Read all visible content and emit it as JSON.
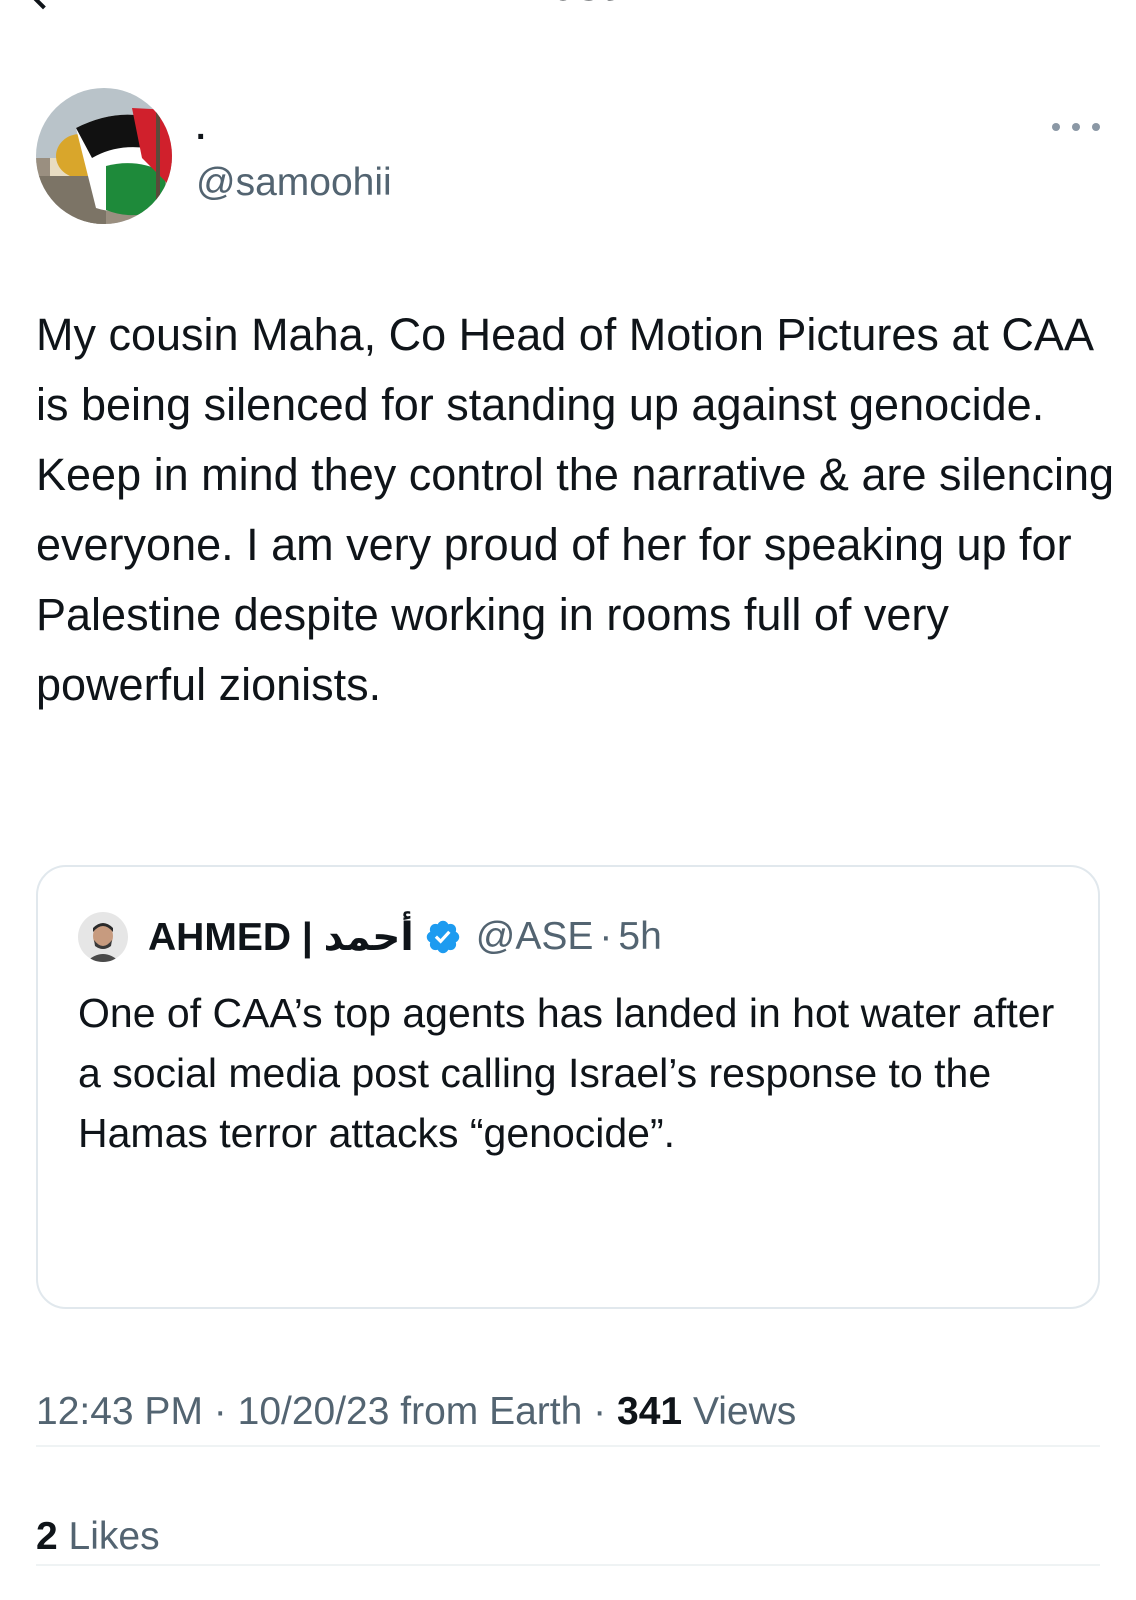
{
  "header": {
    "title": "Post",
    "back_icon": "back-arrow-icon"
  },
  "post": {
    "author": {
      "display_name": ".",
      "handle": "@samoohii",
      "avatar": "palestine-flag-dome-avatar"
    },
    "more_icon": "more-horizontal-icon",
    "text": "My cousin Maha, Co Head of Motion Pictures at CAA is being silenced for standing up against genocide. Keep in mind they control the narrative & are silencing everyone. I am very proud of her for speaking up for Palestine despite working in rooms full of very powerful zionists.",
    "quote": {
      "display_name": "AHMED | أحمد",
      "verified_icon": "verified-badge-icon",
      "verified_color": "#1d9bf0",
      "handle": "@ASE",
      "separator": "·",
      "time": "5h",
      "text": "One of CAA’s top agents has landed in hot water after a social media post calling Israel’s response to the Hamas terror attacks “genocide”."
    },
    "meta": {
      "time": "12:43 PM",
      "sep1": "·",
      "date_source": "10/20/23 from Earth",
      "sep2": "·",
      "views_count": "341",
      "views_label": "Views"
    },
    "likes": {
      "count": "2",
      "label": "Likes"
    }
  }
}
